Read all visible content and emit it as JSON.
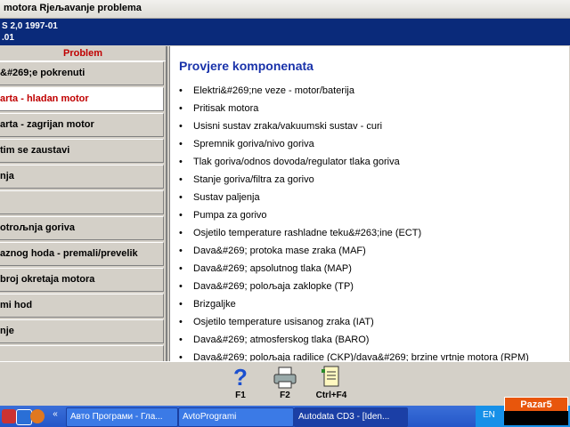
{
  "window": {
    "title": "motora Rjeљavanje problema"
  },
  "vehicle": {
    "line1": "S  2,0  1997-01",
    "line2": ".01"
  },
  "sidebar": {
    "header": "Problem",
    "items": [
      {
        "label": "&#269;e pokrenuti",
        "active": false
      },
      {
        "label": "arta - hladan motor",
        "active": true
      },
      {
        "label": "arta - zagrijan motor",
        "active": false
      },
      {
        "label": "tim se zaustavi",
        "active": false
      },
      {
        "label": "nja",
        "active": false
      },
      {
        "label": "",
        "active": false
      },
      {
        "label": "otroљnja goriva",
        "active": false
      },
      {
        "label": "aznog hoda - premali/prevelik",
        "active": false
      },
      {
        "label": "broj okretaja motora",
        "active": false
      },
      {
        "label": "mi hod",
        "active": false
      },
      {
        "label": "nje",
        "active": false
      },
      {
        "label": "",
        "active": false
      }
    ]
  },
  "content": {
    "title": "Provjere komponenata",
    "items": [
      "Elektri&#269;ne veze - motor/baterija",
      "Pritisak motora",
      "Usisni sustav zraka/vakuumski sustav - curi",
      "Spremnik goriva/nivo goriva",
      "Tlak goriva/odnos dovoda/regulator tlaka goriva",
      "Stanje goriva/filtra za gorivo",
      "Sustav paljenja",
      "Pumpa za gorivo",
      "Osjetilo temperature rashladne teku&#263;ine (ECT)",
      "Dava&#269; protoka mase zraka (MAF)",
      "Dava&#269; apsolutnog tlaka (MAP)",
      "Dava&#269; poloљaja zaklopke (TP)",
      "Brizgaljke",
      "Osjetilo temperature usisanog zraka (IAT)",
      "Dava&#269; atmosferskog tlaka (BARO)",
      "Dava&#269; poloљaja radilice (CKP)/dava&#269; brzine vrtnje motora (RPM)"
    ]
  },
  "toolbar": {
    "keys": [
      {
        "label": "F1",
        "icon": "help-icon"
      },
      {
        "label": "F2",
        "icon": "printer-icon"
      },
      {
        "label": "Ctrl+F4",
        "icon": "notes-icon"
      }
    ]
  },
  "taskbar": {
    "tasks": [
      {
        "label": "Авто Програми - Гла...",
        "active": false
      },
      {
        "label": "AvtoProgrami",
        "active": false
      },
      {
        "label": "Autodata CD3 - [Iden...",
        "active": true
      }
    ],
    "language": "EN"
  },
  "watermark": {
    "text": "Pazar5"
  },
  "colors": {
    "accent_blue": "#0a2a7a",
    "problem_red": "#c00000",
    "title_blue": "#1a33aa"
  }
}
